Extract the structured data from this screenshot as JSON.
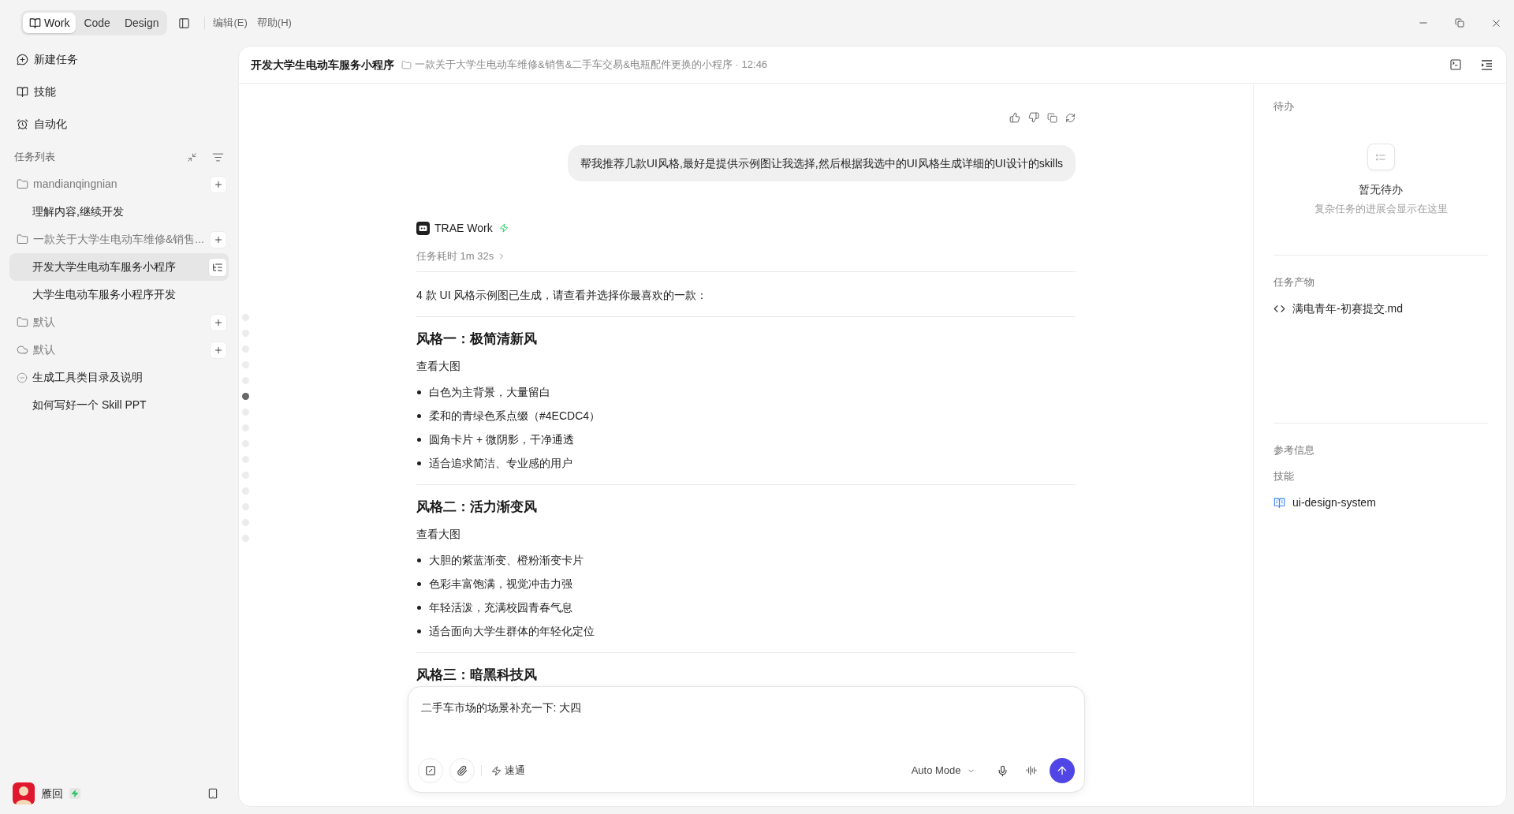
{
  "window": {
    "mode_tabs": [
      {
        "label": "Work",
        "kind": "icon",
        "selected": true
      },
      {
        "label": "Code",
        "kind": "text",
        "selected": false
      },
      {
        "label": "Design",
        "kind": "text",
        "selected": false
      }
    ],
    "menu": [
      "编辑(E)",
      "帮助(H)"
    ]
  },
  "sidebar": {
    "nav": [
      {
        "kind": "new",
        "label": "新建任务"
      },
      {
        "kind": "skills",
        "label": "技能"
      },
      {
        "kind": "automation",
        "label": "自动化"
      }
    ],
    "task_list_title": "任务列表",
    "groups": [
      {
        "kind": "folder",
        "label": "mandianqingnian",
        "children": [
          {
            "label": "理解内容,继续开发",
            "selected": false,
            "stopped": false
          }
        ]
      },
      {
        "kind": "folder",
        "label": "一款关于大学生电动车维修&销售...",
        "children": [
          {
            "label": "开发大学生电动车服务小程序",
            "selected": true,
            "stopped": false
          },
          {
            "label": "大学生电动车服务小程序开发",
            "selected": false,
            "stopped": false
          }
        ]
      },
      {
        "kind": "folder",
        "label": "默认"
      },
      {
        "kind": "cloud",
        "label": "默认",
        "children": [
          {
            "label": "生成工具类目录及说明",
            "selected": false,
            "stopped": true
          },
          {
            "label": "如何写好一个 Skill PPT",
            "selected": false,
            "stopped": false
          }
        ]
      }
    ],
    "user": {
      "name": "雁回"
    }
  },
  "header": {
    "title": "开发大学生电动车服务小程序",
    "subtitle": "一款关于大学生电动车维修&销售&二手车交易&电瓶配件更换的小程序 · 12:46"
  },
  "message_nav": [
    {
      "selected": false
    },
    {
      "selected": false
    },
    {
      "selected": false
    },
    {
      "selected": false
    },
    {
      "selected": false
    },
    {
      "selected": true
    },
    {
      "selected": false
    },
    {
      "selected": false
    },
    {
      "selected": false
    },
    {
      "selected": false
    },
    {
      "selected": false
    },
    {
      "selected": false
    },
    {
      "selected": false
    },
    {
      "selected": false
    },
    {
      "selected": false
    }
  ],
  "chat": {
    "user_message": "帮我推荐几款UI风格,最好是提供示例图让我选择,然后根据我选中的UI风格生成详细的UI设计的skills",
    "assistant": {
      "name": "TRAE Work",
      "duration": "任务耗时 1m 32s",
      "intro": "4 款 UI 风格示例图已生成，请查看并选择你最喜欢的一款：",
      "sections": [
        {
          "heading": "风格一：极简清新风",
          "link": "查看大图",
          "bullets": [
            "白色为主背景，大量留白",
            "柔和的青绿色系点缀（#4ECDC4）",
            "圆角卡片 + 微阴影，干净通透",
            "适合追求简洁、专业感的用户"
          ]
        },
        {
          "heading": "风格二：活力渐变风",
          "link": "查看大图",
          "bullets": [
            "大胆的紫蓝渐变、橙粉渐变卡片",
            "色彩丰富饱满，视觉冲击力强",
            "年轻活泼，充满校园青春气息",
            "适合面向大学生群体的年轻化定位"
          ]
        },
        {
          "heading": "风格三：暗黑科技风"
        }
      ]
    }
  },
  "composer": {
    "value": "二手车市场的场景补充一下: 大四",
    "speed_label": "速通",
    "mode": "Auto Mode"
  },
  "side_panel": {
    "todo": {
      "title": "待办",
      "empty_title": "暂无待办",
      "empty_hint": "复杂任务的进展会显示在这里"
    },
    "artifacts": {
      "title": "任务产物",
      "items": [
        {
          "kind": "code",
          "name": "满电青年-初赛提交.md"
        }
      ]
    },
    "references": {
      "title": "参考信息",
      "skills_title": "技能",
      "skills": [
        "ui-design-system"
      ]
    }
  }
}
